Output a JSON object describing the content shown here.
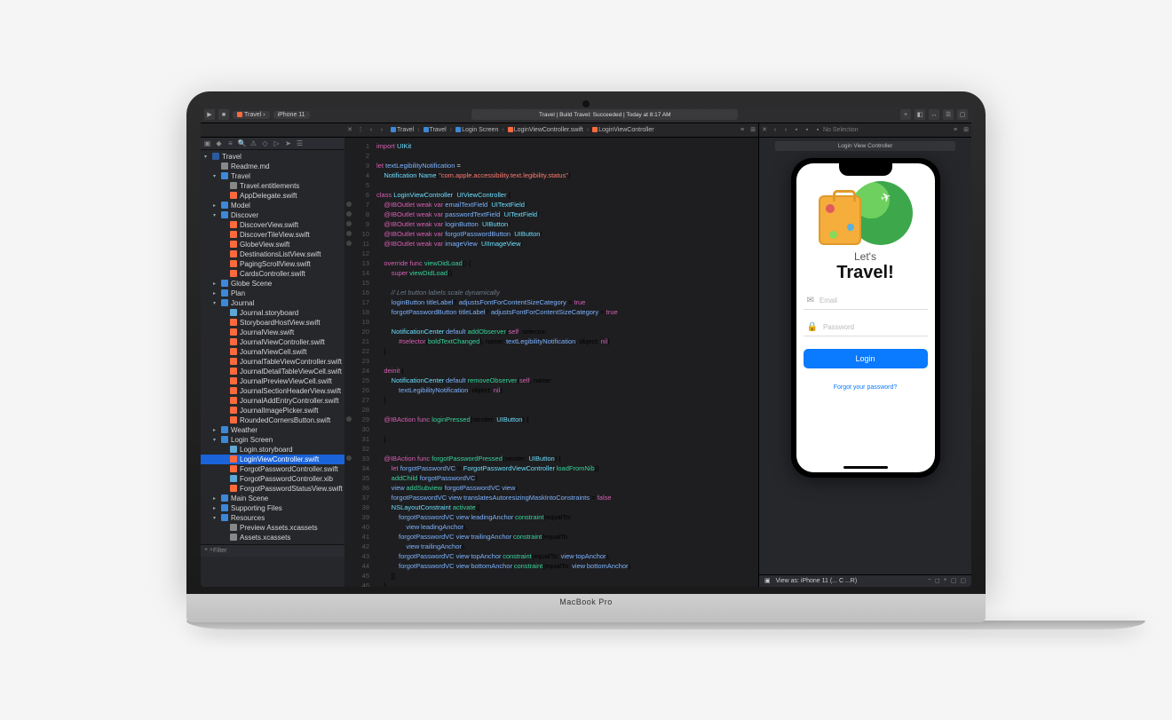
{
  "toolbar": {
    "scheme": "Travel",
    "destination": "iPhone 11",
    "status": "Travel | Build Travel: Succeeded | Today at 8:17 AM"
  },
  "path_bar": {
    "crumbs": [
      "Travel",
      "Travel",
      "Login Screen",
      "LoginViewController.swift",
      "LoginViewController"
    ],
    "no_selection": "No Selection"
  },
  "canvas": {
    "header": "Login View Controller",
    "lets": "Let's",
    "travel": "Travel!",
    "email_placeholder": "Email",
    "password_placeholder": "Password",
    "login_button": "Login",
    "forgot": "Forgot your password?",
    "footer_view": "View as: iPhone 11 (... C ...R)"
  },
  "filter_placeholder": "Filter",
  "base_label": "MacBook Pro",
  "navigator": {
    "project": "Travel",
    "readme": "Readme.md",
    "groups": [
      {
        "name": "Travel",
        "expanded": true,
        "children": [
          {
            "name": "Travel.entitlements",
            "icon": "md"
          },
          {
            "name": "AppDelegate.swift",
            "icon": "sw"
          }
        ]
      },
      {
        "name": "Model",
        "expanded": false
      },
      {
        "name": "Discover",
        "expanded": true,
        "children": [
          {
            "name": "DiscoverView.swift",
            "icon": "sw"
          },
          {
            "name": "DiscoverTileView.swift",
            "icon": "sw"
          },
          {
            "name": "GlobeView.swift",
            "icon": "sw"
          },
          {
            "name": "DestinationsListView.swift",
            "icon": "sw"
          },
          {
            "name": "PagingScrollView.swift",
            "icon": "sw"
          },
          {
            "name": "CardsController.swift",
            "icon": "sw"
          }
        ]
      },
      {
        "name": "Globe Scene",
        "expanded": false
      },
      {
        "name": "Plan",
        "expanded": false
      },
      {
        "name": "Journal",
        "expanded": true,
        "children": [
          {
            "name": "Journal.storyboard",
            "icon": "sb"
          },
          {
            "name": "StoryboardHostView.swift",
            "icon": "sw"
          },
          {
            "name": "JournalView.swift",
            "icon": "sw"
          },
          {
            "name": "JournalViewController.swift",
            "icon": "sw"
          },
          {
            "name": "JournalViewCell.swift",
            "icon": "sw"
          },
          {
            "name": "JournalTableViewController.swift",
            "icon": "sw"
          },
          {
            "name": "JournalDetailTableViewCell.swift",
            "icon": "sw"
          },
          {
            "name": "JournalPreviewViewCell.swift",
            "icon": "sw"
          },
          {
            "name": "JournalSectionHeaderView.swift",
            "icon": "sw"
          },
          {
            "name": "JournalAddEntryController.swift",
            "icon": "sw"
          },
          {
            "name": "JournalImagePicker.swift",
            "icon": "sw"
          },
          {
            "name": "RoundedCornersButton.swift",
            "icon": "sw"
          }
        ]
      },
      {
        "name": "Weather",
        "expanded": false
      },
      {
        "name": "Login Screen",
        "expanded": true,
        "children": [
          {
            "name": "Login.storyboard",
            "icon": "sb"
          },
          {
            "name": "LoginViewController.swift",
            "icon": "sw",
            "selected": true
          },
          {
            "name": "ForgotPasswordController.swift",
            "icon": "sw"
          },
          {
            "name": "ForgotPasswordController.xib",
            "icon": "sb"
          },
          {
            "name": "ForgotPasswordStatusView.swift",
            "icon": "sw"
          }
        ]
      },
      {
        "name": "Main Scene",
        "expanded": false
      },
      {
        "name": "Supporting Files",
        "expanded": false
      },
      {
        "name": "Resources",
        "expanded": true,
        "children": [
          {
            "name": "Preview Assets.xcassets",
            "icon": "md"
          },
          {
            "name": "Assets.xcassets",
            "icon": "md"
          }
        ]
      }
    ]
  },
  "code": {
    "lines": [
      {
        "n": 1,
        "html": "<span class='kw'>import</span> <span class='ty'>UIKit</span>"
      },
      {
        "n": 2,
        "html": ""
      },
      {
        "n": 3,
        "html": "<span class='kw'>let</span> <span class='id'>textLegibilityNotification</span> <span class='pl'>=</span>"
      },
      {
        "n": 4,
        "html": "    <span class='ty'>Notification</span>.<span class='ty'>Name</span>(<span class='str'>\"com.apple.accessibility.text.legibility.status\"</span>)"
      },
      {
        "n": 5,
        "html": ""
      },
      {
        "n": 6,
        "html": "<span class='kw'>class</span> <span class='ty'>LoginViewController</span>: <span class='ty'>UIViewController</span> {"
      },
      {
        "n": 7,
        "dot": true,
        "html": "    <span class='at'>@IBOutlet</span> <span class='kw'>weak</span> <span class='kw'>var</span> <span class='id'>emailTextField</span>: <span class='ty'>UITextField</span>!"
      },
      {
        "n": 8,
        "dot": true,
        "html": "    <span class='at'>@IBOutlet</span> <span class='kw'>weak</span> <span class='kw'>var</span> <span class='id'>passwordTextField</span>: <span class='ty'>UITextField</span>!"
      },
      {
        "n": 9,
        "dot": true,
        "html": "    <span class='at'>@IBOutlet</span> <span class='kw'>weak</span> <span class='kw'>var</span> <span class='id'>loginButton</span>: <span class='ty'>UIButton</span>!"
      },
      {
        "n": 10,
        "dot": true,
        "html": "    <span class='at'>@IBOutlet</span> <span class='kw'>weak</span> <span class='kw'>var</span> <span class='id'>forgotPasswordButton</span>: <span class='ty'>UIButton</span>!"
      },
      {
        "n": 11,
        "dot": true,
        "html": "    <span class='at'>@IBOutlet</span> <span class='kw'>weak</span> <span class='kw'>var</span> <span class='id'>imageView</span>: <span class='ty'>UIImageView</span>!"
      },
      {
        "n": 12,
        "html": ""
      },
      {
        "n": 13,
        "html": "    <span class='kw'>override</span> <span class='kw'>func</span> <span class='fn'>viewDidLoad</span>() {"
      },
      {
        "n": 14,
        "html": "        <span class='kw'>super</span>.<span class='fn'>viewDidLoad</span>()"
      },
      {
        "n": 15,
        "html": ""
      },
      {
        "n": 16,
        "html": "        <span class='cm'>// Let button labels scale dynamically</span>"
      },
      {
        "n": 17,
        "html": "        <span class='id'>loginButton</span>.<span class='prop'>titleLabel</span>?.<span class='prop'>adjustsFontForContentSizeCategory</span> = <span class='kw'>true</span>"
      },
      {
        "n": 18,
        "html": "        <span class='id'>forgotPasswordButton</span>.<span class='prop'>titleLabel</span>?.<span class='prop'>adjustsFontForContentSizeCategory</span> = <span class='kw'>true</span>"
      },
      {
        "n": 19,
        "html": ""
      },
      {
        "n": 20,
        "html": "        <span class='ty'>NotificationCenter</span>.<span class='prop'>default</span>.<span class='fn'>addObserver</span>(<span class='kw'>self</span>, selector:"
      },
      {
        "n": 21,
        "html": "            <span class='kw'>#selector</span>(<span class='fn'>boldTextChanged</span>), name: <span class='id'>textLegibilityNotification</span>, object: <span class='kw'>nil</span>)"
      },
      {
        "n": 22,
        "html": "    }"
      },
      {
        "n": 23,
        "html": ""
      },
      {
        "n": 24,
        "html": "    <span class='kw'>deinit</span> {"
      },
      {
        "n": 25,
        "html": "        <span class='ty'>NotificationCenter</span>.<span class='prop'>default</span>.<span class='fn'>removeObserver</span>(<span class='kw'>self</span>, name:"
      },
      {
        "n": 26,
        "html": "            <span class='id'>textLegibilityNotification</span>, object: <span class='kw'>nil</span>)"
      },
      {
        "n": 27,
        "html": "    }"
      },
      {
        "n": 28,
        "html": ""
      },
      {
        "n": 29,
        "dot": true,
        "html": "    <span class='at'>@IBAction</span> <span class='kw'>func</span> <span class='fn'>loginPressed</span>(sender: <span class='ty'>UIButton</span>) {"
      },
      {
        "n": 30,
        "html": ""
      },
      {
        "n": 31,
        "html": "    }"
      },
      {
        "n": 32,
        "html": ""
      },
      {
        "n": 33,
        "dot": true,
        "html": "    <span class='at'>@IBAction</span> <span class='kw'>func</span> <span class='fn'>forgotPasswordPressed</span>(sender: <span class='ty'>UIButton</span>) {"
      },
      {
        "n": 34,
        "html": "        <span class='kw'>let</span> <span class='id'>forgotPasswordVC</span> = <span class='ty'>ForgotPasswordViewController</span>.<span class='fn'>loadFromNib</span>()"
      },
      {
        "n": 35,
        "html": "        <span class='fn'>addChild</span>(<span class='id'>forgotPasswordVC</span>)"
      },
      {
        "n": 36,
        "html": "        <span class='id'>view</span>.<span class='fn'>addSubview</span>(<span class='id'>forgotPasswordVC</span>.<span class='prop'>view</span>)"
      },
      {
        "n": 37,
        "html": "        <span class='id'>forgotPasswordVC</span>.<span class='prop'>view</span>.<span class='prop'>translatesAutoresizingMaskIntoConstraints</span> = <span class='kw'>false</span>"
      },
      {
        "n": 38,
        "html": "        <span class='ty'>NSLayoutConstraint</span>.<span class='fn'>activate</span>(["
      },
      {
        "n": 39,
        "html": "            <span class='id'>forgotPasswordVC</span>.<span class='prop'>view</span>.<span class='prop'>leadingAnchor</span>.<span class='fn'>constraint</span>(equalTo:"
      },
      {
        "n": 40,
        "html": "                <span class='id'>view</span>.<span class='prop'>leadingAnchor</span>),"
      },
      {
        "n": 41,
        "html": "            <span class='id'>forgotPasswordVC</span>.<span class='prop'>view</span>.<span class='prop'>trailingAnchor</span>.<span class='fn'>constraint</span>(equalTo:"
      },
      {
        "n": 42,
        "html": "                <span class='id'>view</span>.<span class='prop'>trailingAnchor</span>),"
      },
      {
        "n": 43,
        "html": "            <span class='id'>forgotPasswordVC</span>.<span class='prop'>view</span>.<span class='prop'>topAnchor</span>.<span class='fn'>constraint</span>(equalTo: <span class='id'>view</span>.<span class='prop'>topAnchor</span>),"
      },
      {
        "n": 44,
        "html": "            <span class='id'>forgotPasswordVC</span>.<span class='prop'>view</span>.<span class='prop'>bottomAnchor</span>.<span class='fn'>constraint</span>(equalTo: <span class='id'>view</span>.<span class='prop'>bottomAnchor</span>)"
      },
      {
        "n": 45,
        "html": "        ])"
      },
      {
        "n": 46,
        "html": "    }"
      }
    ]
  }
}
